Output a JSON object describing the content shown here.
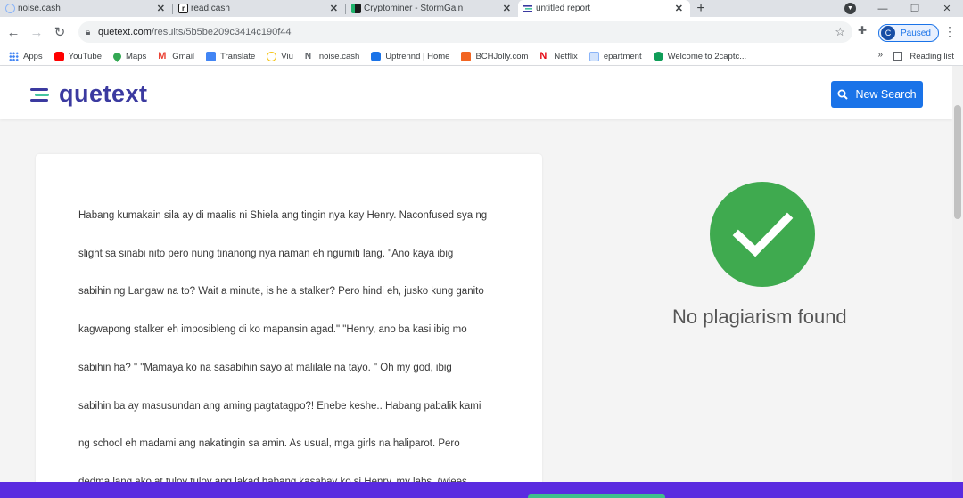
{
  "browser": {
    "tabs": [
      {
        "title": "noise.cash",
        "close": "✕",
        "favicon_color": "#e8eaed"
      },
      {
        "title": "read.cash",
        "close": "✕",
        "favicon_color": "#1b1b1b"
      },
      {
        "title": "Cryptominer - StormGain",
        "close": "✕",
        "favicon_color": "#1fb36b"
      },
      {
        "title": "untitled report",
        "close": "✕",
        "favicon_color": "#3b3aa0"
      }
    ],
    "new_tab": "+",
    "url_host": "quetext.com",
    "url_path": "/results/5b5be209c3414c190f44",
    "profile_initial": "C",
    "profile_status": "Paused",
    "bookmarks": [
      {
        "label": "Apps",
        "color": "#4285f4"
      },
      {
        "label": "YouTube",
        "color": "#ff0000"
      },
      {
        "label": "Maps",
        "color": "#34a853"
      },
      {
        "label": "Gmail",
        "color": "#ea4335"
      },
      {
        "label": "Translate",
        "color": "#4285f4"
      },
      {
        "label": "Viu",
        "color": "#f5c518"
      },
      {
        "label": "noise.cash",
        "color": "#9aa0a6"
      },
      {
        "label": "Uptrennd | Home",
        "color": "#1a73e8"
      },
      {
        "label": "BCHJolly.com",
        "color": "#f26522"
      },
      {
        "label": "Netflix",
        "color": "#e50914"
      },
      {
        "label": "epartment",
        "color": "#8ab4f8"
      },
      {
        "label": "Welcome to 2captc...",
        "color": "#0f9d58"
      }
    ],
    "bookmarks_more": "»",
    "reading_list": "Reading list"
  },
  "site": {
    "logo_text": "quetext",
    "new_search_label": "New Search",
    "brand_color": "#3b3aa0",
    "button_color": "#1a73e8"
  },
  "document": {
    "lines": [
      "Habang kumakain sila ay di maalis ni Shiela ang tingin nya kay Henry. Naconfused sya ng",
      "slight sa sinabi nito pero nung tinanong nya naman eh ngumiti lang. \"Ano kaya ibig",
      "sabihin ng Langaw na to? Wait a minute, is he a stalker? Pero hindi eh, jusko kung ganito",
      "kagwapong stalker eh imposibleng di ko mapansin agad.\" \"Henry, ano ba kasi ibig mo",
      "sabihin ha? \" \"Mamaya ko na sasabihin sayo at malilate na tayo. \" Oh my god, ibig",
      "sabihin ba ay masusundan ang aming pagtatagpo?! Enebe keshe.. Habang pabalik kami",
      "ng school eh madami ang nakatingin sa amin. As usual, mga girls na haliparot. Pero",
      "dedma lang ako at tuloy tuloy ang lakad habang kasabay ko si Henry, my labs. (wiees"
    ]
  },
  "result": {
    "status_text": "No plagiarism found",
    "status_color": "#3faa4f"
  },
  "footer": {
    "bar_color": "#5a2be0"
  }
}
